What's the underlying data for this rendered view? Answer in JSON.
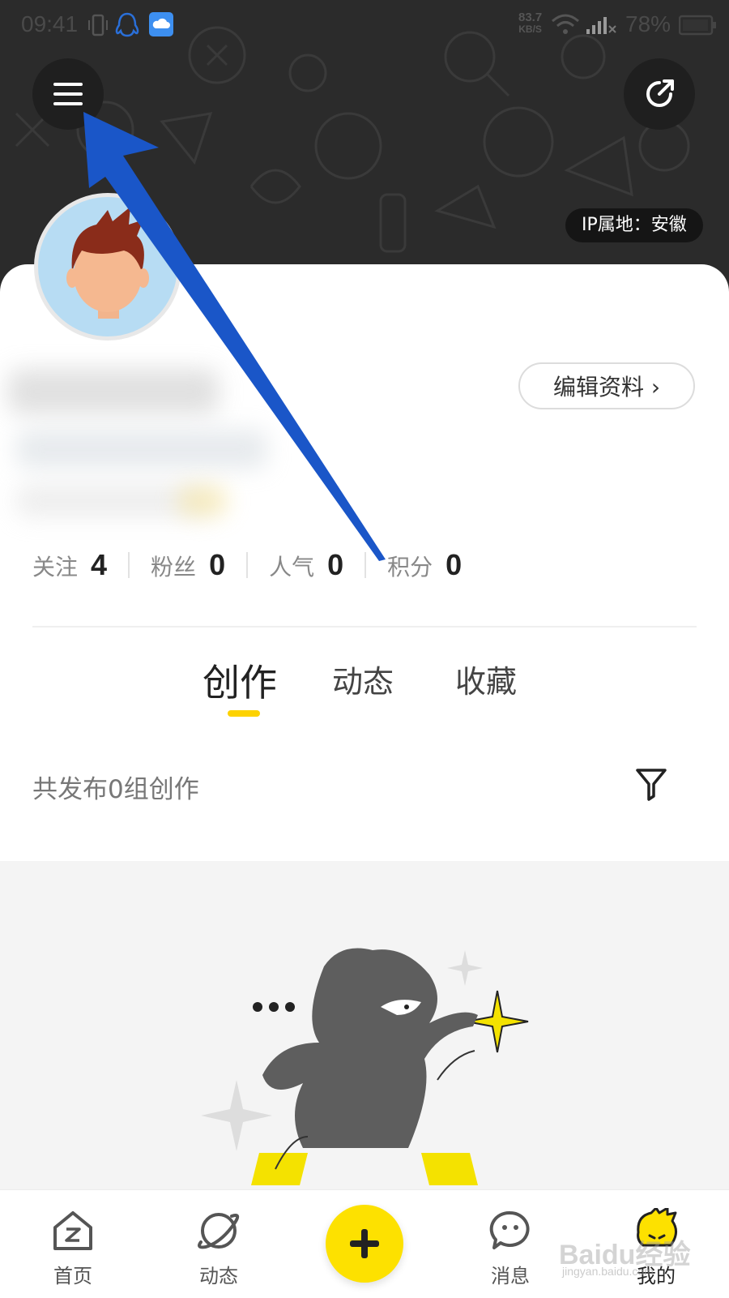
{
  "status_bar": {
    "time": "09:41",
    "net_speed": "83.7",
    "net_unit": "KB/S",
    "battery": "78%"
  },
  "header": {
    "ip_location": "IP属地：安徽"
  },
  "profile": {
    "edit_label": "编辑资料 ›"
  },
  "stats": [
    {
      "label": "关注",
      "value": "4"
    },
    {
      "label": "粉丝",
      "value": "0"
    },
    {
      "label": "人气",
      "value": "0"
    },
    {
      "label": "积分",
      "value": "0"
    }
  ],
  "tabs": [
    {
      "label": "创作",
      "active": true
    },
    {
      "label": "动态",
      "active": false
    },
    {
      "label": "收藏",
      "active": false
    }
  ],
  "content": {
    "count_text": "共发布0组创作"
  },
  "bottom_nav": [
    {
      "label": "首页",
      "icon": "home-icon"
    },
    {
      "label": "动态",
      "icon": "planet-icon"
    },
    {
      "label": "",
      "icon": "plus-icon"
    },
    {
      "label": "消息",
      "icon": "message-icon"
    },
    {
      "label": "我的",
      "icon": "profile-mascot-icon"
    }
  ],
  "watermark": {
    "brand": "Baidu经验",
    "url": "jingyan.baidu.com"
  },
  "colors": {
    "header_bg": "#2b2b2b",
    "accent_yellow": "#fde100",
    "annotation_arrow": "#1a56c8"
  }
}
